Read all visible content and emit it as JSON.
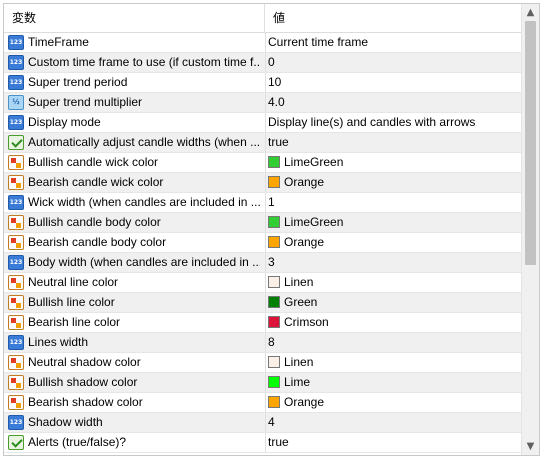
{
  "header": {
    "col_name": "変数",
    "col_value": "値"
  },
  "rows": [
    {
      "icon": "integer-icon",
      "icon_text": "123",
      "name": "TimeFrame",
      "value": "Current time frame"
    },
    {
      "icon": "integer-icon",
      "icon_text": "123",
      "name": "Custom time frame to use (if custom time f...",
      "value": "0"
    },
    {
      "icon": "integer-icon",
      "icon_text": "123",
      "name": "Super trend period",
      "value": "10"
    },
    {
      "icon": "double-icon",
      "icon_text": "½",
      "name": "Super trend multiplier",
      "value": "4.0"
    },
    {
      "icon": "integer-icon",
      "icon_text": "123",
      "name": "Display mode",
      "value": "Display line(s) and candles with arrows"
    },
    {
      "icon": "boolean-icon",
      "icon_text": "",
      "name": "Automatically adjust candle widths (when ...",
      "value": "true"
    },
    {
      "icon": "color-icon",
      "icon_text": "",
      "name": "Bullish candle wick color",
      "value": "LimeGreen",
      "swatch": "#32cd32"
    },
    {
      "icon": "color-icon",
      "icon_text": "",
      "name": "Bearish candle wick color",
      "value": "Orange",
      "swatch": "#ffa500"
    },
    {
      "icon": "integer-icon",
      "icon_text": "123",
      "name": "Wick width (when candles are included in ...",
      "value": "1"
    },
    {
      "icon": "color-icon",
      "icon_text": "",
      "name": "Bullish candle body color",
      "value": "LimeGreen",
      "swatch": "#32cd32"
    },
    {
      "icon": "color-icon",
      "icon_text": "",
      "name": "Bearish candle body color",
      "value": "Orange",
      "swatch": "#ffa500"
    },
    {
      "icon": "integer-icon",
      "icon_text": "123",
      "name": "Body width (when candles are included in ...",
      "value": "3"
    },
    {
      "icon": "color-icon",
      "icon_text": "",
      "name": "Neutral line color",
      "value": "Linen",
      "swatch": "#faf0e6"
    },
    {
      "icon": "color-icon",
      "icon_text": "",
      "name": "Bullish line color",
      "value": "Green",
      "swatch": "#008000"
    },
    {
      "icon": "color-icon",
      "icon_text": "",
      "name": "Bearish line color",
      "value": "Crimson",
      "swatch": "#dc143c"
    },
    {
      "icon": "integer-icon",
      "icon_text": "123",
      "name": "Lines width",
      "value": "8"
    },
    {
      "icon": "color-icon",
      "icon_text": "",
      "name": "Neutral shadow color",
      "value": "Linen",
      "swatch": "#faf0e6"
    },
    {
      "icon": "color-icon",
      "icon_text": "",
      "name": "Bullish shadow color",
      "value": "Lime",
      "swatch": "#00ff00"
    },
    {
      "icon": "color-icon",
      "icon_text": "",
      "name": "Bearish shadow color",
      "value": "Orange",
      "swatch": "#ffa500"
    },
    {
      "icon": "integer-icon",
      "icon_text": "123",
      "name": "Shadow width",
      "value": "4"
    },
    {
      "icon": "boolean-icon",
      "icon_text": "",
      "name": "Alerts (true/false)?",
      "value": "true"
    }
  ],
  "scrollbar": {
    "up_icon": "scroll-up-arrow-icon",
    "down_icon": "scroll-down-arrow-icon"
  }
}
